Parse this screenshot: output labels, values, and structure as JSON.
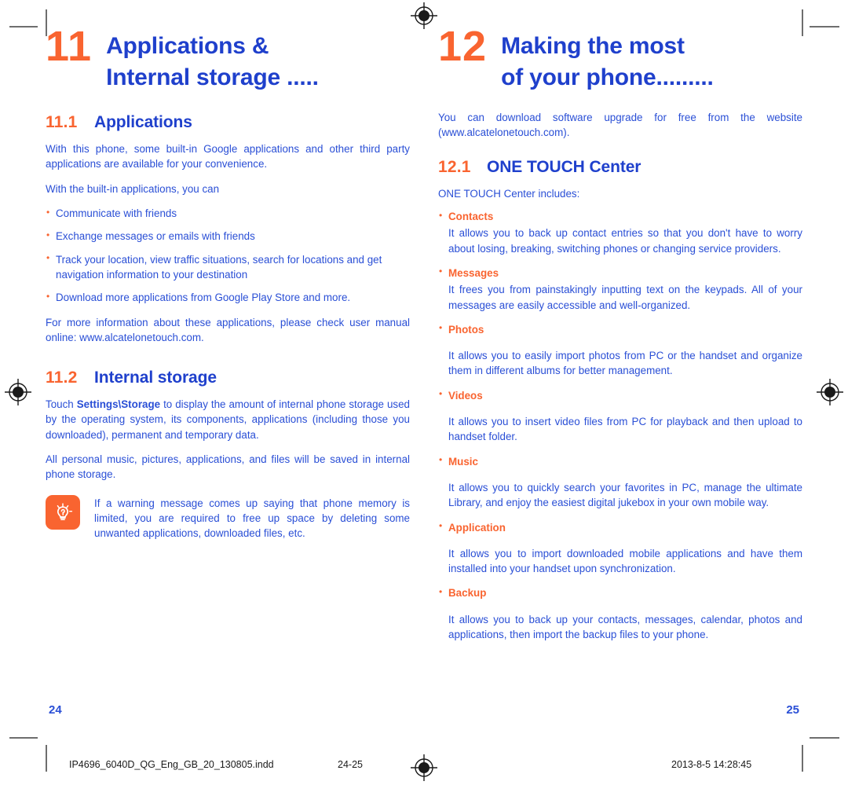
{
  "colors": {
    "accent_orange": "#f96430",
    "heading_blue": "#1f40cc",
    "body_blue": "#2a4fd6"
  },
  "left_page": {
    "chapter": {
      "number": "11",
      "title_line1": "Applications &",
      "title_line2": "Internal storage ....."
    },
    "section_11_1": {
      "number": "11.1",
      "name": "Applications",
      "para1": "With this phone, some built-in Google applications and other third party applications are available for your convenience.",
      "para2": "With the built-in applications, you can",
      "bullets": [
        "Communicate with friends",
        "Exchange messages or emails with friends",
        "Track your location, view traffic situations, search for locations and get navigation information to your destination",
        "Download more applications from Google Play Store and more."
      ],
      "para3": "For more information about these applications, please check user manual online: www.alcatelonetouch.com."
    },
    "section_11_2": {
      "number": "11.2",
      "name": "Internal storage",
      "para1_prefix": "Touch ",
      "para1_bold": "Settings\\Storage",
      "para1_suffix": " to display the amount of internal phone storage used by the operating system, its components, applications (including those you downloaded), permanent and temporary data.",
      "para2": "All personal music, pictures, applications, and files will be saved in internal phone storage.",
      "tip": {
        "icon": "lightbulb-icon",
        "text": "If a warning message comes up saying that phone memory is limited, you are required to free up space by deleting some unwanted applications, downloaded files, etc."
      }
    },
    "page_number": "24"
  },
  "right_page": {
    "chapter": {
      "number": "12",
      "title_line1": "Making the most",
      "title_line2": "of your phone........."
    },
    "intro": "You can download software upgrade for free from the website (www.alcatelonetouch.com).",
    "section_12_1": {
      "number": "12.1",
      "name": "ONE TOUCH Center",
      "lead": "ONE TOUCH Center includes:",
      "features": [
        {
          "title": "Contacts",
          "gap": false,
          "body": "It allows you to back up contact entries so that you don't have to worry about losing, breaking, switching phones or changing service providers."
        },
        {
          "title": "Messages",
          "gap": false,
          "body": "It frees you from painstakingly inputting text on the keypads. All of your messages are easily accessible and well-organized."
        },
        {
          "title": "Photos",
          "gap": true,
          "body": "It allows you to easily import photos from PC or the handset and organize them in different albums for better management."
        },
        {
          "title": "Videos",
          "gap": true,
          "body": "It allows you to insert video files from PC for playback and then upload to handset folder."
        },
        {
          "title": "Music",
          "gap": true,
          "body": "It allows you to quickly search your favorites in PC, manage the ultimate Library, and enjoy the easiest digital jukebox in your own mobile way."
        },
        {
          "title": "Application",
          "gap": true,
          "body": "It allows you to import downloaded mobile applications and have them installed into your handset upon synchronization."
        },
        {
          "title": "Backup",
          "gap": true,
          "body": "It allows you to back up your contacts, messages, calendar, photos and applications, then import the backup files to your phone."
        }
      ]
    },
    "page_number": "25"
  },
  "footer": {
    "filename": "IP4696_6040D_QG_Eng_GB_20_130805.indd",
    "page_range": "24-25",
    "timestamp": "2013-8-5   14:28:45"
  }
}
